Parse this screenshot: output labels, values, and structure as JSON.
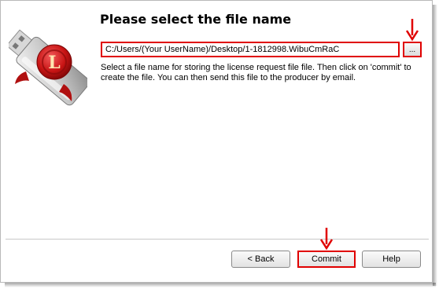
{
  "dialog": {
    "title": "Please select the file name",
    "file_path": "C:/Users/(Your UserName)/Desktop/1-1812998.WibuCmRaC",
    "browse_label": "...",
    "description": "Select a file name for storing the license request file file. Then click on 'commit' to create the file. You can then send this file to the producer by email."
  },
  "buttons": {
    "back": "< Back",
    "commit": "Commit",
    "help": "Help"
  },
  "logo": {
    "seal_letter": "L",
    "icon": "usb-dongle-with-wax-seal-icon"
  },
  "annotations": {
    "color": "#e00000",
    "arrow_icon": "down-arrow-icon"
  }
}
